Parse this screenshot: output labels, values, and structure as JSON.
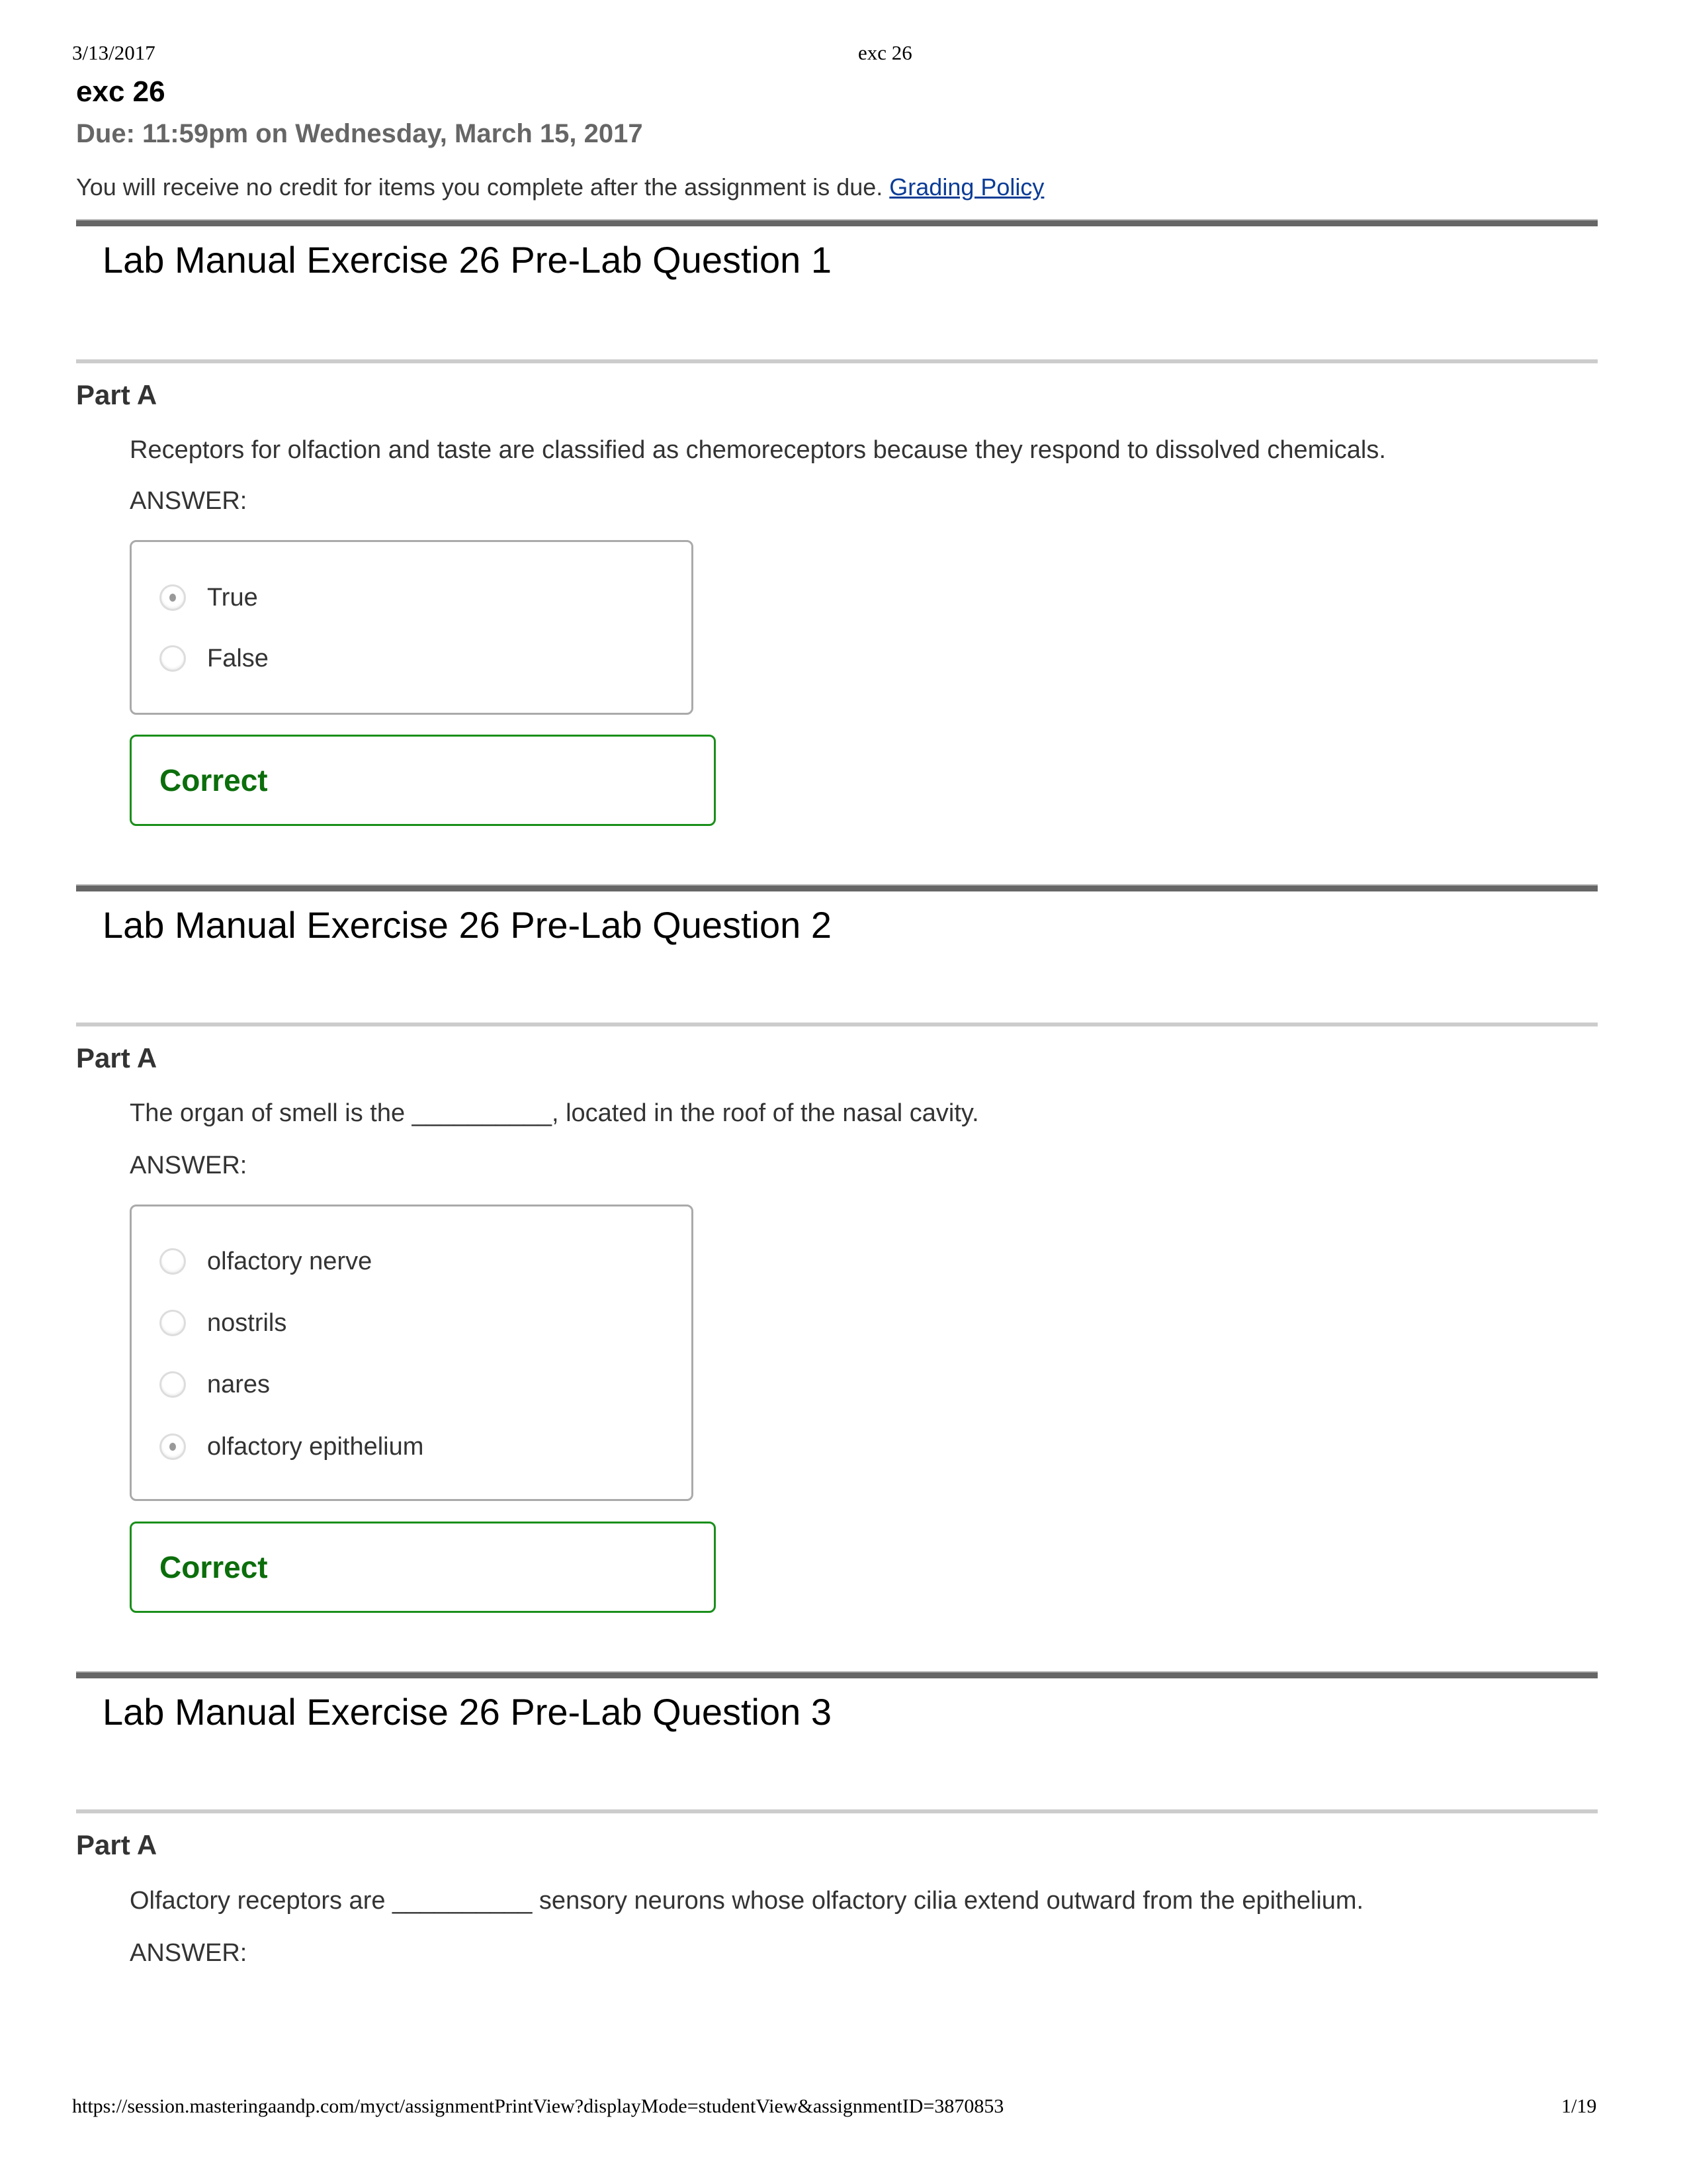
{
  "print_header": {
    "date": "3/13/2017",
    "title": "exc 26"
  },
  "assignment": {
    "title": "exc 26",
    "due": "Due: 11:59pm on Wednesday, March 15, 2017",
    "notice": "You will receive no credit for items you complete after the assignment is due.",
    "grading_policy_link": "Grading Policy"
  },
  "questions": [
    {
      "title": "Lab Manual Exercise 26 Pre-Lab Question 1",
      "part": "Part A",
      "text": "Receptors for olfaction and taste are classified as chemoreceptors because they respond to dissolved chemicals.",
      "answer_label": "ANSWER:",
      "options": [
        {
          "label": "True",
          "selected": true
        },
        {
          "label": "False",
          "selected": false
        }
      ],
      "feedback": "Correct"
    },
    {
      "title": "Lab Manual Exercise 26 Pre-Lab Question 2",
      "part": "Part A",
      "text": "The organ of smell is the __________, located in the roof of the nasal cavity.",
      "answer_label": "ANSWER:",
      "options": [
        {
          "label": "olfactory nerve",
          "selected": false
        },
        {
          "label": "nostrils",
          "selected": false
        },
        {
          "label": "nares",
          "selected": false
        },
        {
          "label": "olfactory epithelium",
          "selected": true
        }
      ],
      "feedback": "Correct"
    },
    {
      "title": "Lab Manual Exercise 26 Pre-Lab Question 3",
      "part": "Part A",
      "text": "Olfactory receptors are __________ sensory neurons whose olfactory cilia extend outward from the epithelium.",
      "answer_label": "ANSWER:"
    }
  ],
  "print_footer": {
    "url": "https://session.masteringaandp.com/myct/assignmentPrintView?displayMode=studentView&assignmentID=3870853",
    "page": "1/19"
  },
  "colors": {
    "correct": "#0b6e0b",
    "correct_border": "#1a8f1a",
    "link": "#0b3c96",
    "due_text": "#666666"
  }
}
